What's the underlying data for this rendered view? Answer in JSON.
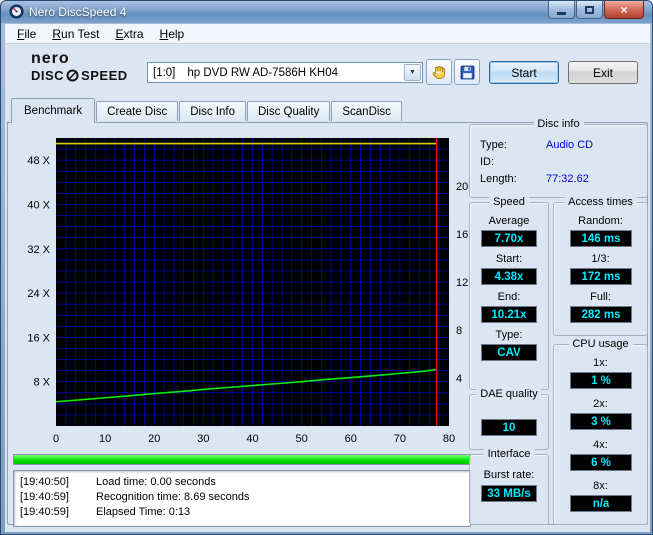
{
  "window": {
    "title": "Nero DiscSpeed 4"
  },
  "menu": {
    "items": [
      "File",
      "Run Test",
      "Extra",
      "Help"
    ]
  },
  "toolbar": {
    "logo_line1": "nero",
    "logo_disc": "DISC",
    "logo_speed": "SPEED",
    "drive_bus": "[1:0]",
    "drive_name": "hp DVD RW AD-7586H KH04",
    "start_label": "Start",
    "exit_label": "Exit"
  },
  "icons": {
    "chevron_down": "▼",
    "close_glyph": "×"
  },
  "tabs": [
    {
      "label": "Benchmark",
      "active": true
    },
    {
      "label": "Create Disc",
      "active": false
    },
    {
      "label": "Disc Info",
      "active": false
    },
    {
      "label": "Disc Quality",
      "active": false
    },
    {
      "label": "ScanDisc",
      "active": false
    }
  ],
  "chart_data": {
    "type": "line",
    "x_range": [
      0,
      80
    ],
    "x_ticks": [
      0,
      10,
      20,
      30,
      40,
      50,
      60,
      70,
      80
    ],
    "y_left_range": [
      0,
      52
    ],
    "y_left_ticks": [
      {
        "value": 48,
        "label": "48 X"
      },
      {
        "value": 40,
        "label": "40 X"
      },
      {
        "value": 32,
        "label": "32 X"
      },
      {
        "value": 24,
        "label": "24 X"
      },
      {
        "value": 16,
        "label": "16 X"
      },
      {
        "value": 8,
        "label": "8 X"
      }
    ],
    "y_right_range": [
      0,
      24
    ],
    "y_right_ticks": [
      {
        "value": 20,
        "label": "20"
      },
      {
        "value": 16,
        "label": "16"
      },
      {
        "value": 12,
        "label": "12"
      },
      {
        "value": 8,
        "label": "8"
      },
      {
        "value": 4,
        "label": "4"
      }
    ],
    "grid_step_x": 2,
    "grid_step_y": 2,
    "series": [
      {
        "name": "read-speed",
        "color": "#00ee00",
        "axis": "left",
        "points": [
          [
            0,
            4.38
          ],
          [
            5,
            4.72
          ],
          [
            10,
            5.1
          ],
          [
            15,
            5.45
          ],
          [
            20,
            5.85
          ],
          [
            25,
            6.2
          ],
          [
            30,
            6.6
          ],
          [
            35,
            6.95
          ],
          [
            40,
            7.3
          ],
          [
            45,
            7.65
          ],
          [
            50,
            8.0
          ],
          [
            55,
            8.4
          ],
          [
            60,
            8.75
          ],
          [
            65,
            9.1
          ],
          [
            70,
            9.5
          ],
          [
            75,
            9.9
          ],
          [
            77.5,
            10.21
          ]
        ]
      },
      {
        "name": "rotation-speed",
        "color": "#cfcf00",
        "axis": "left",
        "points": [
          [
            0,
            51
          ],
          [
            77.5,
            51
          ]
        ]
      }
    ],
    "end_line_x": 77.5
  },
  "progress": {
    "percent": 100
  },
  "log": {
    "lines": [
      {
        "time": "[19:40:50]",
        "text": "Load time: 0.00 seconds"
      },
      {
        "time": "[19:40:59]",
        "text": "Recognition time: 8.69 seconds"
      },
      {
        "time": "[19:40:59]",
        "text": "Elapsed Time:  0:13"
      }
    ]
  },
  "disc_info": {
    "title": "Disc info",
    "type_label": "Type:",
    "type_value": "Audio CD",
    "id_label": "ID:",
    "id_value": "",
    "length_label": "Length:",
    "length_value": "77:32.62"
  },
  "speed": {
    "title": "Speed",
    "rows": [
      {
        "label": "Average",
        "value": "7.70x"
      },
      {
        "label": "Start:",
        "value": "4.38x"
      },
      {
        "label": "End:",
        "value": "10.21x"
      },
      {
        "label": "Type:",
        "value": "CAV"
      }
    ]
  },
  "access_times": {
    "title": "Access times",
    "rows": [
      {
        "label": "Random:",
        "value": "146 ms"
      },
      {
        "label": "1/3:",
        "value": "172 ms"
      },
      {
        "label": "Full:",
        "value": "282 ms"
      }
    ]
  },
  "cpu_usage": {
    "title": "CPU usage",
    "rows": [
      {
        "label": "1x:",
        "value": "1 %"
      },
      {
        "label": "2x:",
        "value": "3 %"
      },
      {
        "label": "4x:",
        "value": "6 %"
      },
      {
        "label": "8x:",
        "value": "n/a"
      }
    ]
  },
  "dae_quality": {
    "title": "DAE quality",
    "value": "10"
  },
  "interface": {
    "title": "Interface",
    "burst_label": "Burst rate:",
    "burst_value": "33 MB/s"
  },
  "colors": {
    "value_bg": "#000000",
    "value_text": "#00eaff",
    "disc_info_value": "#0000cc",
    "grid": "#0000cc",
    "read_curve": "#00ee00",
    "rotation_curve": "#cfcf00",
    "end_line": "#ff0000",
    "progress": "#00dd00",
    "chart_bg": "#000000"
  }
}
